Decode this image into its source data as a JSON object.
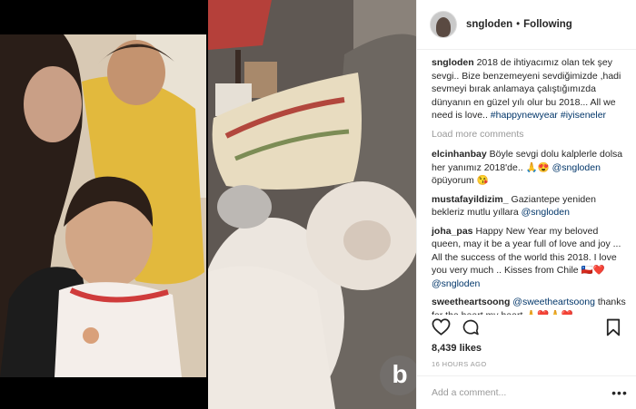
{
  "post": {
    "username": "sngloden",
    "follow_separator": "•",
    "follow_status": "Following"
  },
  "caption": {
    "user": "sngloden",
    "text": "2018 de ihtiyacımız olan tek şey sevgi.. Bize benzemeyeni sevdiğimizde ,hadi sevmeyi bırak anlamaya çalıştığımızda dünyanın en güzel yılı olur bu 2018... All we need is love.. ",
    "hashtags": [
      "#happynewyear",
      "#iyiseneler"
    ]
  },
  "load_more": "Load more comments",
  "comments": [
    {
      "user": "elcinhanbay",
      "text": "Böyle sevgi dolu kalplerle dolsa her yanımız 2018'de.. 🙏😍",
      "mention": "@sngloden",
      "after": " öpüyorum 😘"
    },
    {
      "user": "mustafayildizim_",
      "text": "Gaziantepe yeniden bekleriz mutlu yıllara ",
      "mention": "@sngloden",
      "after": ""
    },
    {
      "user": "joha_pas",
      "text": "Happy New Year my beloved queen, may it be a year full of love and joy ... All the success of the world this 2018. I love you very much .. Kisses from Chile 🇨🇱❤️ ",
      "mention": "@sngloden",
      "after": ""
    },
    {
      "user": "sweetheartsoong",
      "text": "",
      "mention": "@sweetheartsoong",
      "after": " thanks for the heart my heart 🙏❤️🙏❤️"
    }
  ],
  "likes": "8,439 likes",
  "timestamp": "16 HOURS AGO",
  "comment_box": {
    "placeholder": "Add a comment...",
    "more": "•••"
  },
  "watermark": "b",
  "icons": [
    "heart-icon",
    "comment-icon",
    "bookmark-icon",
    "more-options-icon"
  ],
  "colors": {
    "link": "#003569",
    "muted": "#999999",
    "text": "#262626",
    "border": "#efefef"
  }
}
